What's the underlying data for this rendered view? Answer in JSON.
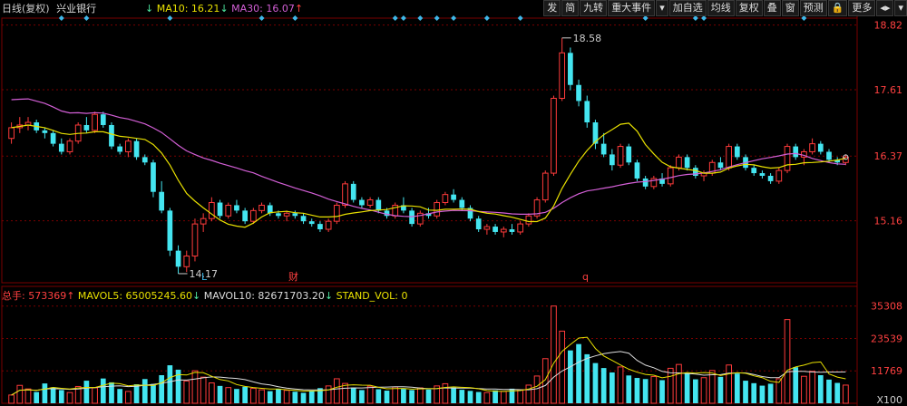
{
  "header": {
    "period": "日线(复权)",
    "stock_name": "兴业银行",
    "ma10_label": "MA10: 16.21",
    "ma10_arrow": "↓",
    "ma30_label": "MA30: 16.07",
    "ma30_arrow": "↑"
  },
  "toolbar": {
    "items": [
      "发",
      "简",
      "九转",
      "重大事件",
      "▾",
      "加自选",
      "均线",
      "复权",
      "叠",
      "窗",
      "预测",
      "🔒",
      "更多",
      "◂▸",
      "▾"
    ]
  },
  "price_axis": {
    "labels": [
      "18.82",
      "17.61",
      "16.37",
      "15.16"
    ],
    "values": [
      18.82,
      17.61,
      16.37,
      15.16
    ],
    "min": 14.0,
    "max": 18.95
  },
  "annotations": {
    "high": "18.58",
    "low": "14.17",
    "marker_l": "L",
    "marker_cai": "财",
    "marker_q": "q"
  },
  "volume_header": {
    "total": "总手: 573369",
    "total_arrow": "↑",
    "mavol5": "MAVOL5: 65005245.60",
    "mavol5_arrow": "↓",
    "mavol10": "MAVOL10: 82671703.20",
    "mavol10_arrow": "↓",
    "stand_vol": "STAND_VOL: 0"
  },
  "volume_axis": {
    "labels": [
      "35308",
      "23539",
      "11769",
      "X100"
    ],
    "values": [
      35308,
      23539,
      11769,
      0
    ]
  },
  "colors": {
    "up": "#ff3b3b",
    "down": "#44e5f0",
    "ma10": "#e8e000",
    "ma30": "#d35fd6",
    "grid": "#7a0000"
  },
  "chart_data": {
    "type": "candlestick",
    "ohlc": [
      [
        16.7,
        17.0,
        16.6,
        16.9
      ],
      [
        16.9,
        17.1,
        16.8,
        16.95
      ],
      [
        16.95,
        17.1,
        16.85,
        17.0
      ],
      [
        17.0,
        17.05,
        16.8,
        16.85
      ],
      [
        16.85,
        16.9,
        16.7,
        16.8
      ],
      [
        16.8,
        16.85,
        16.55,
        16.6
      ],
      [
        16.6,
        16.7,
        16.4,
        16.45
      ],
      [
        16.45,
        16.7,
        16.4,
        16.65
      ],
      [
        16.65,
        17.0,
        16.6,
        16.95
      ],
      [
        16.95,
        17.1,
        16.8,
        16.85
      ],
      [
        16.85,
        17.2,
        16.8,
        17.15
      ],
      [
        17.15,
        17.2,
        16.9,
        16.95
      ],
      [
        16.95,
        17.0,
        16.5,
        16.55
      ],
      [
        16.55,
        16.6,
        16.4,
        16.45
      ],
      [
        16.45,
        16.7,
        16.35,
        16.65
      ],
      [
        16.65,
        16.7,
        16.3,
        16.35
      ],
      [
        16.35,
        16.4,
        16.2,
        16.25
      ],
      [
        16.25,
        16.3,
        15.6,
        15.7
      ],
      [
        15.7,
        15.9,
        15.3,
        15.35
      ],
      [
        15.35,
        15.4,
        14.5,
        14.6
      ],
      [
        14.6,
        14.7,
        14.17,
        14.3
      ],
      [
        14.3,
        14.6,
        14.2,
        14.5
      ],
      [
        14.5,
        15.2,
        14.4,
        15.1
      ],
      [
        15.1,
        15.3,
        14.95,
        15.2
      ],
      [
        15.2,
        15.6,
        15.15,
        15.5
      ],
      [
        15.5,
        15.55,
        15.2,
        15.25
      ],
      [
        15.25,
        15.5,
        15.2,
        15.45
      ],
      [
        15.45,
        15.55,
        15.3,
        15.35
      ],
      [
        15.35,
        15.4,
        15.1,
        15.15
      ],
      [
        15.15,
        15.4,
        15.1,
        15.35
      ],
      [
        15.35,
        15.5,
        15.3,
        15.45
      ],
      [
        15.45,
        15.5,
        15.25,
        15.3
      ],
      [
        15.3,
        15.35,
        15.2,
        15.25
      ],
      [
        15.25,
        15.35,
        15.15,
        15.3
      ],
      [
        15.3,
        15.35,
        15.2,
        15.25
      ],
      [
        15.25,
        15.3,
        15.1,
        15.15
      ],
      [
        15.15,
        15.2,
        15.05,
        15.1
      ],
      [
        15.1,
        15.15,
        14.95,
        15.0
      ],
      [
        15.0,
        15.2,
        14.95,
        15.15
      ],
      [
        15.15,
        15.5,
        15.1,
        15.45
      ],
      [
        15.45,
        15.9,
        15.4,
        15.85
      ],
      [
        15.85,
        15.9,
        15.5,
        15.55
      ],
      [
        15.55,
        15.6,
        15.4,
        15.45
      ],
      [
        15.45,
        15.6,
        15.4,
        15.55
      ],
      [
        15.55,
        15.6,
        15.3,
        15.35
      ],
      [
        15.35,
        15.4,
        15.2,
        15.25
      ],
      [
        15.25,
        15.5,
        15.2,
        15.45
      ],
      [
        15.45,
        15.6,
        15.3,
        15.35
      ],
      [
        15.35,
        15.4,
        15.05,
        15.1
      ],
      [
        15.1,
        15.35,
        15.05,
        15.3
      ],
      [
        15.3,
        15.4,
        15.2,
        15.25
      ],
      [
        15.25,
        15.55,
        15.2,
        15.5
      ],
      [
        15.5,
        15.7,
        15.45,
        15.65
      ],
      [
        15.65,
        15.75,
        15.5,
        15.55
      ],
      [
        15.55,
        15.6,
        15.35,
        15.4
      ],
      [
        15.4,
        15.45,
        15.15,
        15.2
      ],
      [
        15.2,
        15.25,
        14.95,
        15.0
      ],
      [
        15.0,
        15.1,
        14.9,
        15.05
      ],
      [
        15.05,
        15.1,
        14.9,
        14.95
      ],
      [
        14.95,
        15.05,
        14.85,
        15.0
      ],
      [
        15.0,
        15.1,
        14.9,
        14.95
      ],
      [
        14.95,
        15.15,
        14.9,
        15.1
      ],
      [
        15.1,
        15.3,
        15.05,
        15.25
      ],
      [
        15.25,
        15.6,
        15.2,
        15.55
      ],
      [
        15.55,
        16.1,
        15.5,
        16.05
      ],
      [
        16.05,
        17.5,
        16.0,
        17.45
      ],
      [
        17.45,
        18.58,
        17.4,
        18.3
      ],
      [
        18.3,
        18.4,
        17.6,
        17.7
      ],
      [
        17.7,
        17.8,
        17.3,
        17.4
      ],
      [
        17.4,
        17.5,
        16.9,
        17.0
      ],
      [
        17.0,
        17.05,
        16.5,
        16.6
      ],
      [
        16.6,
        16.8,
        16.35,
        16.4
      ],
      [
        16.4,
        16.5,
        16.1,
        16.2
      ],
      [
        16.2,
        16.6,
        16.15,
        16.55
      ],
      [
        16.55,
        16.6,
        16.2,
        16.25
      ],
      [
        16.25,
        16.3,
        15.9,
        15.95
      ],
      [
        15.95,
        16.0,
        15.75,
        15.8
      ],
      [
        15.8,
        16.0,
        15.75,
        15.95
      ],
      [
        15.95,
        16.05,
        15.8,
        15.85
      ],
      [
        15.85,
        16.2,
        15.8,
        16.15
      ],
      [
        16.15,
        16.4,
        16.1,
        16.35
      ],
      [
        16.35,
        16.4,
        16.1,
        16.15
      ],
      [
        16.15,
        16.2,
        15.95,
        16.0
      ],
      [
        16.0,
        16.1,
        15.9,
        16.05
      ],
      [
        16.05,
        16.3,
        16.0,
        16.25
      ],
      [
        16.25,
        16.35,
        16.1,
        16.15
      ],
      [
        16.15,
        16.6,
        16.1,
        16.55
      ],
      [
        16.55,
        16.6,
        16.3,
        16.35
      ],
      [
        16.35,
        16.4,
        16.1,
        16.15
      ],
      [
        16.15,
        16.2,
        16.0,
        16.05
      ],
      [
        16.05,
        16.1,
        15.95,
        16.0
      ],
      [
        16.0,
        16.05,
        15.85,
        15.9
      ],
      [
        15.9,
        16.15,
        15.85,
        16.1
      ],
      [
        16.1,
        16.6,
        16.05,
        16.55
      ],
      [
        16.55,
        16.6,
        16.3,
        16.35
      ],
      [
        16.35,
        16.5,
        16.2,
        16.45
      ],
      [
        16.45,
        16.7,
        16.4,
        16.6
      ],
      [
        16.6,
        16.65,
        16.4,
        16.45
      ],
      [
        16.45,
        16.5,
        16.25,
        16.3
      ],
      [
        16.3,
        16.35,
        16.2,
        16.25
      ],
      [
        16.25,
        16.4,
        16.2,
        16.35
      ]
    ],
    "volume": [
      3000,
      6500,
      5200,
      4100,
      7200,
      5800,
      4800,
      3900,
      6100,
      8200,
      5600,
      9000,
      7600,
      5200,
      4300,
      6900,
      8800,
      7000,
      10200,
      13800,
      12200,
      8100,
      11800,
      9500,
      7400,
      6300,
      5700,
      5200,
      6000,
      5400,
      4900,
      4400,
      5100,
      4700,
      4200,
      3800,
      4600,
      5500,
      6300,
      8900,
      7200,
      5700,
      4800,
      6200,
      5100,
      4600,
      5900,
      5200,
      4800,
      5600,
      5000,
      6300,
      7100,
      5700,
      4900,
      4500,
      4100,
      3900,
      4700,
      4300,
      5300,
      4900,
      6600,
      9900,
      16200,
      35308,
      26200,
      19200,
      21500,
      17800,
      14600,
      12800,
      11200,
      13200,
      10100,
      9200,
      8800,
      9700,
      8400,
      12700,
      14100,
      10900,
      8700,
      9300,
      11900,
      9600,
      13900,
      10800,
      8200,
      7300,
      6400,
      7100,
      8900,
      30400,
      13100,
      9800,
      11600,
      10200,
      8600,
      7400,
      6600
    ]
  }
}
